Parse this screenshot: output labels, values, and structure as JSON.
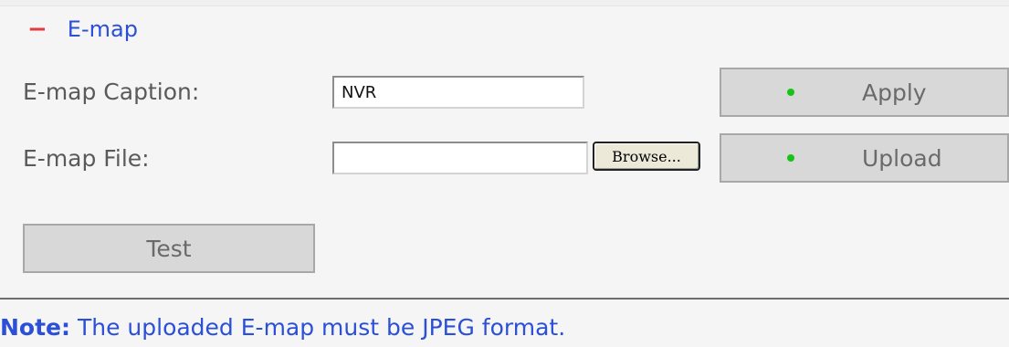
{
  "section": {
    "collapse_symbol": "−",
    "title": "E-map"
  },
  "caption": {
    "label": "E-map Caption:",
    "value": "NVR"
  },
  "file": {
    "label": "E-map File:",
    "value": "",
    "browse_label": "Browse..."
  },
  "buttons": {
    "apply_label": "Apply",
    "upload_label": "Upload",
    "test_label": "Test"
  },
  "note": {
    "label": "Note:",
    "text": " The uploaded E-map must be JPEG format."
  },
  "colors": {
    "accent": "#2b4fd6",
    "collapse": "#e23b3b",
    "status_dot": "#17c317"
  }
}
